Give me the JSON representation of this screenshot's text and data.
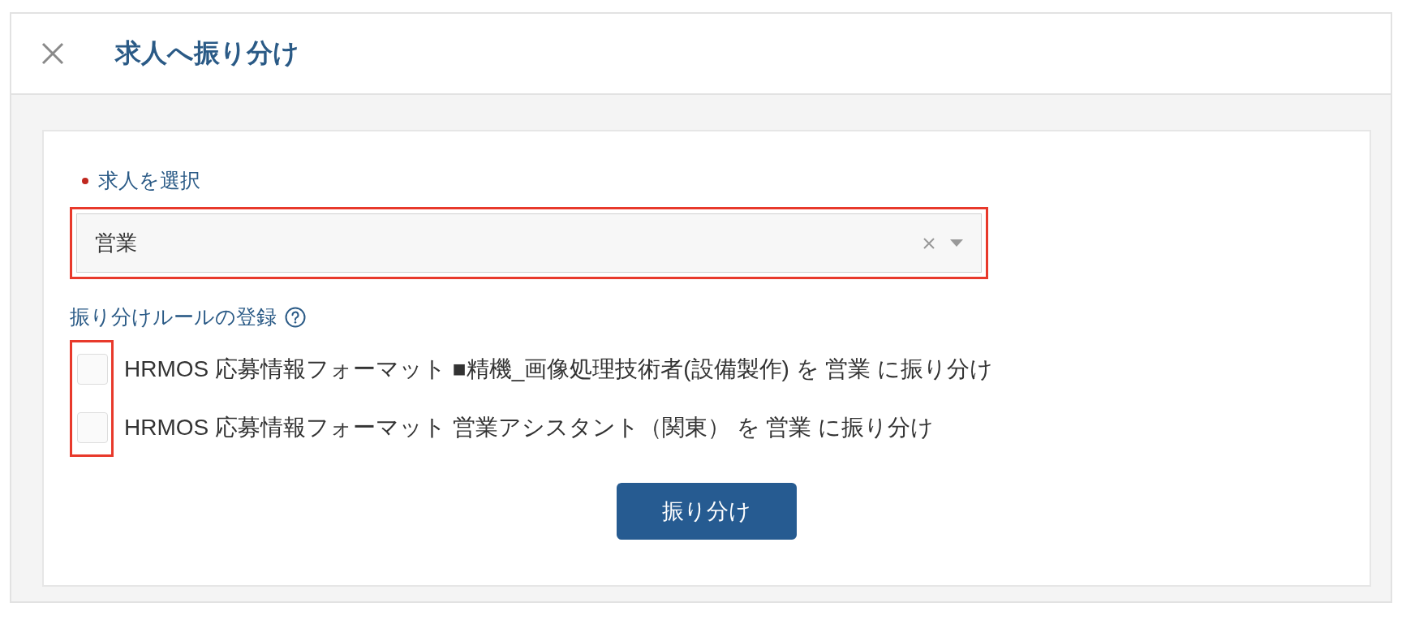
{
  "dialog": {
    "title": "求人へ振り分け"
  },
  "job_select": {
    "label": "求人を選択",
    "required": true,
    "value": "営業",
    "highlighted": true
  },
  "rules": {
    "heading": "振り分けルールの登録",
    "highlighted": true,
    "items": [
      {
        "label": "HRMOS 応募情報フォーマット ■精機_画像処理技術者(設備製作) を 営業 に振り分け",
        "checked": false
      },
      {
        "label": "HRMOS 応募情報フォーマット 営業アシスタント（関東） を 営業 に振り分け",
        "checked": false
      }
    ]
  },
  "submit_button": {
    "label": "振り分け"
  }
}
